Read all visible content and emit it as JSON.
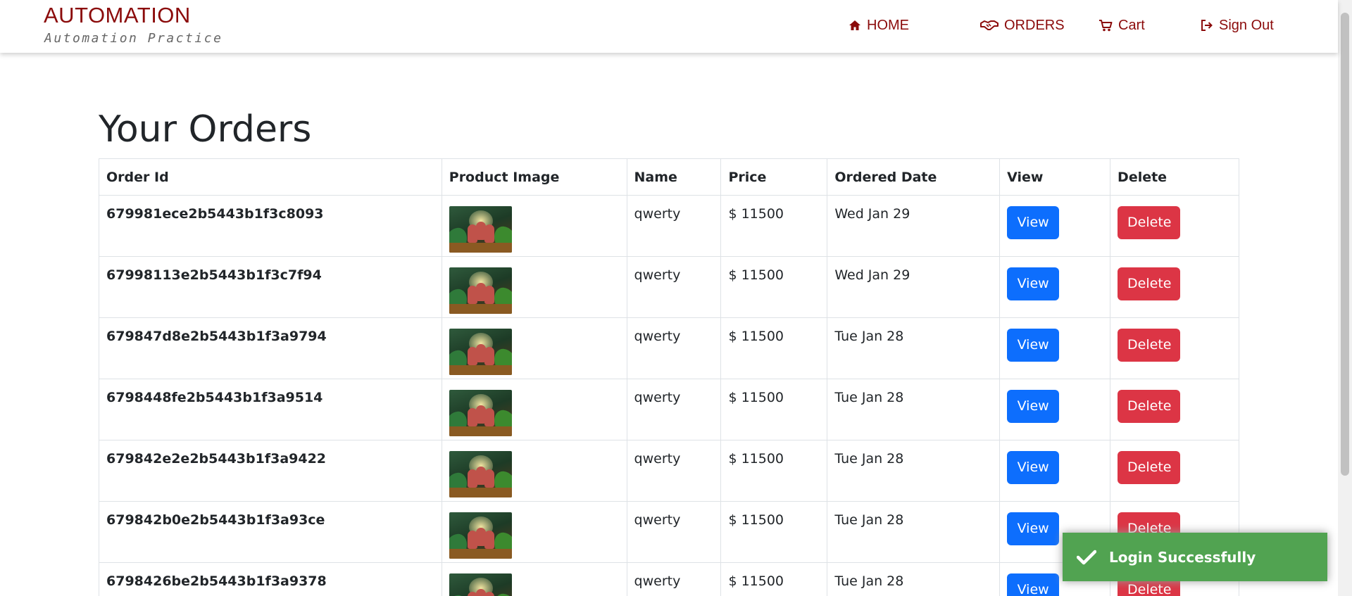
{
  "brand": {
    "title": "AUTOMATION",
    "subtitle": "Automation Practice"
  },
  "nav": {
    "home": "HOME",
    "orders": "ORDERS",
    "cart": "Cart",
    "sign_out": "Sign Out"
  },
  "page_title": "Your Orders",
  "table": {
    "headers": [
      "Order Id",
      "Product Image",
      "Name",
      "Price",
      "Ordered Date",
      "View",
      "Delete"
    ],
    "rows": [
      {
        "order_id": "679981ece2b5443b1f3c8093",
        "name": "qwerty",
        "price": "$ 11500",
        "date": "Wed Jan 29",
        "view": "View",
        "delete": "Delete"
      },
      {
        "order_id": "67998113e2b5443b1f3c7f94",
        "name": "qwerty",
        "price": "$ 11500",
        "date": "Wed Jan 29",
        "view": "View",
        "delete": "Delete"
      },
      {
        "order_id": "679847d8e2b5443b1f3a9794",
        "name": "qwerty",
        "price": "$ 11500",
        "date": "Tue Jan 28",
        "view": "View",
        "delete": "Delete"
      },
      {
        "order_id": "6798448fe2b5443b1f3a9514",
        "name": "qwerty",
        "price": "$ 11500",
        "date": "Tue Jan 28",
        "view": "View",
        "delete": "Delete"
      },
      {
        "order_id": "679842e2e2b5443b1f3a9422",
        "name": "qwerty",
        "price": "$ 11500",
        "date": "Tue Jan 28",
        "view": "View",
        "delete": "Delete"
      },
      {
        "order_id": "679842b0e2b5443b1f3a93ce",
        "name": "qwerty",
        "price": "$ 11500",
        "date": "Tue Jan 28",
        "view": "View",
        "delete": "Delete"
      },
      {
        "order_id": "6798426be2b5443b1f3a9378",
        "name": "qwerty",
        "price": "$ 11500",
        "date": "Tue Jan 28",
        "view": "View",
        "delete": "Delete"
      }
    ]
  },
  "toast": {
    "message": "Login Successfully"
  },
  "colors": {
    "brand": "#8b0b0b",
    "view_button": "#0d6efd",
    "delete_button": "#dc3545",
    "toast_success": "#51a351"
  },
  "icons": {
    "home": "home-icon",
    "orders": "handshake-icon",
    "cart": "cart-icon",
    "sign_out": "sign-out-icon",
    "toast": "check-icon"
  }
}
